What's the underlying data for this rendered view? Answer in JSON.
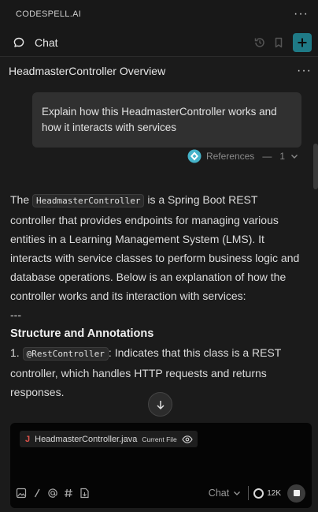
{
  "app": {
    "brand": "CODESPELL.AI",
    "more_label": "···"
  },
  "chat_header": {
    "title": "Chat"
  },
  "conversation": {
    "title": "HeadmasterController Overview",
    "more_label": "···"
  },
  "user_message": "Explain how this HeadmasterController works and how it interacts with services",
  "references": {
    "label": "References",
    "dash": "—",
    "count": "1"
  },
  "answer": {
    "p1_pre": "The ",
    "p1_code": "HeadmasterController",
    "p1_post": " is a Spring Boot REST controller that provides endpoints for managing various entities in a Learning Management System (LMS). It interacts with service classes to perform business logic and database operations. Below is an explanation of how the controller works and its interaction with services:",
    "separator": "---",
    "heading": "Structure and Annotations",
    "item1_num": "1. ",
    "item1_code": "@RestController",
    "item1_post": ": Indicates that this class is a REST controller, which handles HTTP requests and returns responses."
  },
  "composer": {
    "file_icon_letter": "J",
    "file_name": "HeadmasterController.java",
    "file_tag": "Current File",
    "mode": "Chat",
    "tokens": "12K"
  },
  "colors": {
    "accent": "#1f7a86",
    "background": "#1b1b1b",
    "java_icon": "#e0524a"
  }
}
